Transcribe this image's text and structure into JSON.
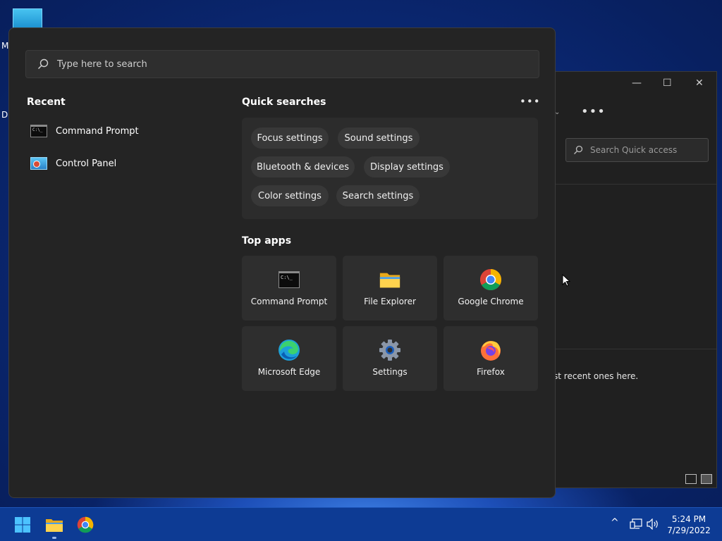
{
  "desktop": {
    "label_m": "M",
    "label_d": "D"
  },
  "explorer_window": {
    "minimize": "—",
    "maximize": "☐",
    "close": "✕",
    "more": "•••",
    "search_placeholder": "Search Quick access",
    "empty_message": "st recent ones here."
  },
  "search": {
    "placeholder": "Type here to search"
  },
  "recent": {
    "title": "Recent",
    "items": [
      {
        "label": "Command Prompt",
        "icon": "command-prompt-icon"
      },
      {
        "label": "Control Panel",
        "icon": "control-panel-icon"
      }
    ]
  },
  "quick_searches": {
    "title": "Quick searches",
    "more": "•••",
    "chips": [
      "Focus settings",
      "Sound settings",
      "Bluetooth & devices",
      "Display settings",
      "Color settings",
      "Search settings"
    ]
  },
  "top_apps": {
    "title": "Top apps",
    "apps": [
      {
        "label": "Command Prompt",
        "icon": "command-prompt-icon"
      },
      {
        "label": "File Explorer",
        "icon": "folder-icon"
      },
      {
        "label": "Google Chrome",
        "icon": "chrome-icon"
      },
      {
        "label": "Microsoft Edge",
        "icon": "edge-icon"
      },
      {
        "label": "Settings",
        "icon": "gear-icon"
      },
      {
        "label": "Firefox",
        "icon": "firefox-icon"
      }
    ]
  },
  "taskbar": {
    "time": "5:24 PM",
    "date": "7/29/2022",
    "tray_chevron": "^"
  },
  "colors": {
    "panel_bg": "#242424",
    "taskbar_bg": "#0d3b94",
    "accent": "#0078d4"
  }
}
